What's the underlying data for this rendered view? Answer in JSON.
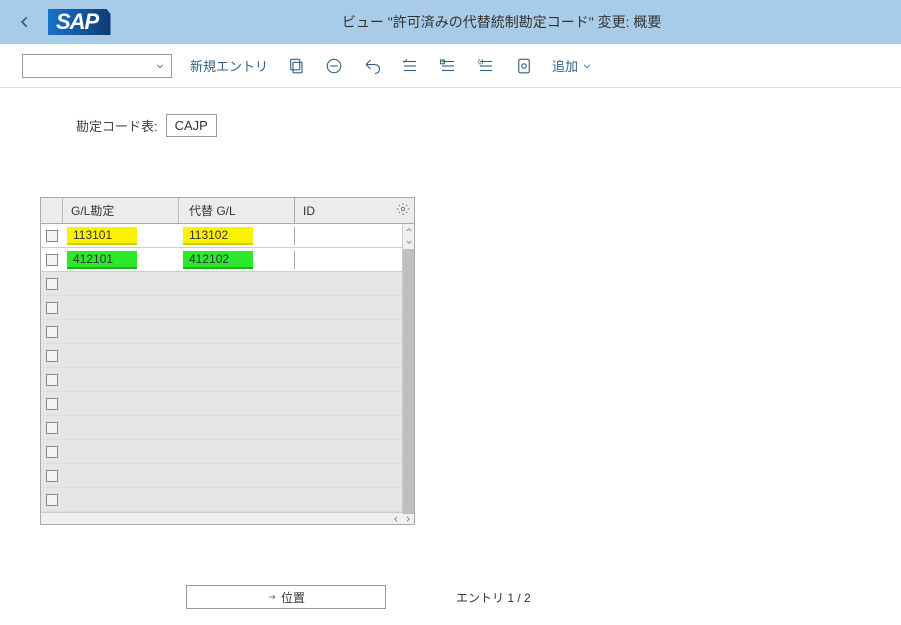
{
  "header": {
    "title": "ビュー \"許可済みの代替統制勘定コード\" 変更: 概要"
  },
  "toolbar": {
    "new_entry": "新規エントリ",
    "add_menu": "追加"
  },
  "field": {
    "label": "勘定コード表:",
    "value": "CAJP"
  },
  "table": {
    "headers": {
      "gl": "G/L勘定",
      "alt": "代替 G/L",
      "id": "ID"
    },
    "rows": [
      {
        "gl": "113101",
        "alt": "113102",
        "id": "",
        "highlight": "yellow"
      },
      {
        "gl": "412101",
        "alt": "412102",
        "id": "",
        "highlight": "green"
      }
    ],
    "empty_rows": 10
  },
  "footer": {
    "position_btn": "位置",
    "entry_count": "エントリ 1 / 2"
  }
}
